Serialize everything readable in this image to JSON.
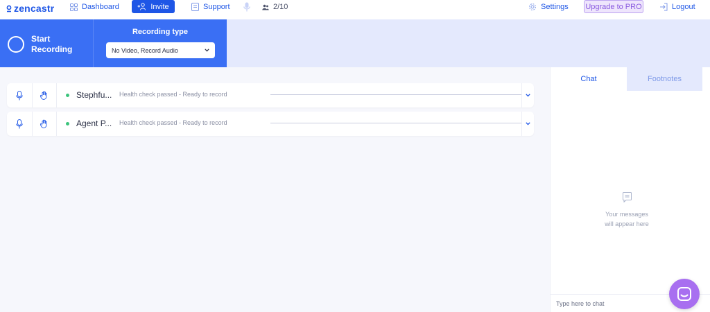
{
  "app": {
    "logo_text": "zencastr"
  },
  "nav": {
    "dashboard": "Dashboard",
    "invite": "Invite",
    "support": "Support",
    "participant_count": "2/10",
    "settings": "Settings",
    "upgrade": "Upgrade to PRO",
    "logout": "Logout"
  },
  "recording": {
    "start_label": "Start Recording",
    "type_label": "Recording type",
    "type_value": "No Video, Record Audio"
  },
  "participants": [
    {
      "name": "Stephfu...",
      "status": "Health check passed - Ready to record"
    },
    {
      "name": "Agent P...",
      "status": "Health check passed - Ready to record"
    }
  ],
  "chat": {
    "tab_chat": "Chat",
    "tab_footnotes": "Footnotes",
    "empty_line1": "Your messages",
    "empty_line2": "will appear here",
    "input_placeholder": "Type here to chat"
  },
  "colors": {
    "brand": "#1e56e6",
    "record_panel": "#3a6ff4",
    "band": "#e4e9fd",
    "upgrade_text": "#8a5be0",
    "status_dot": "#3cc47c",
    "support_bubble": "#a86ff0"
  },
  "icons": [
    "logo-icon",
    "grid-icon",
    "add-user-icon",
    "document-icon",
    "microphone-icon",
    "users-icon",
    "gear-icon",
    "logout-icon",
    "chevron-down-icon",
    "hand-icon",
    "chat-icon",
    "intercom-icon"
  ]
}
